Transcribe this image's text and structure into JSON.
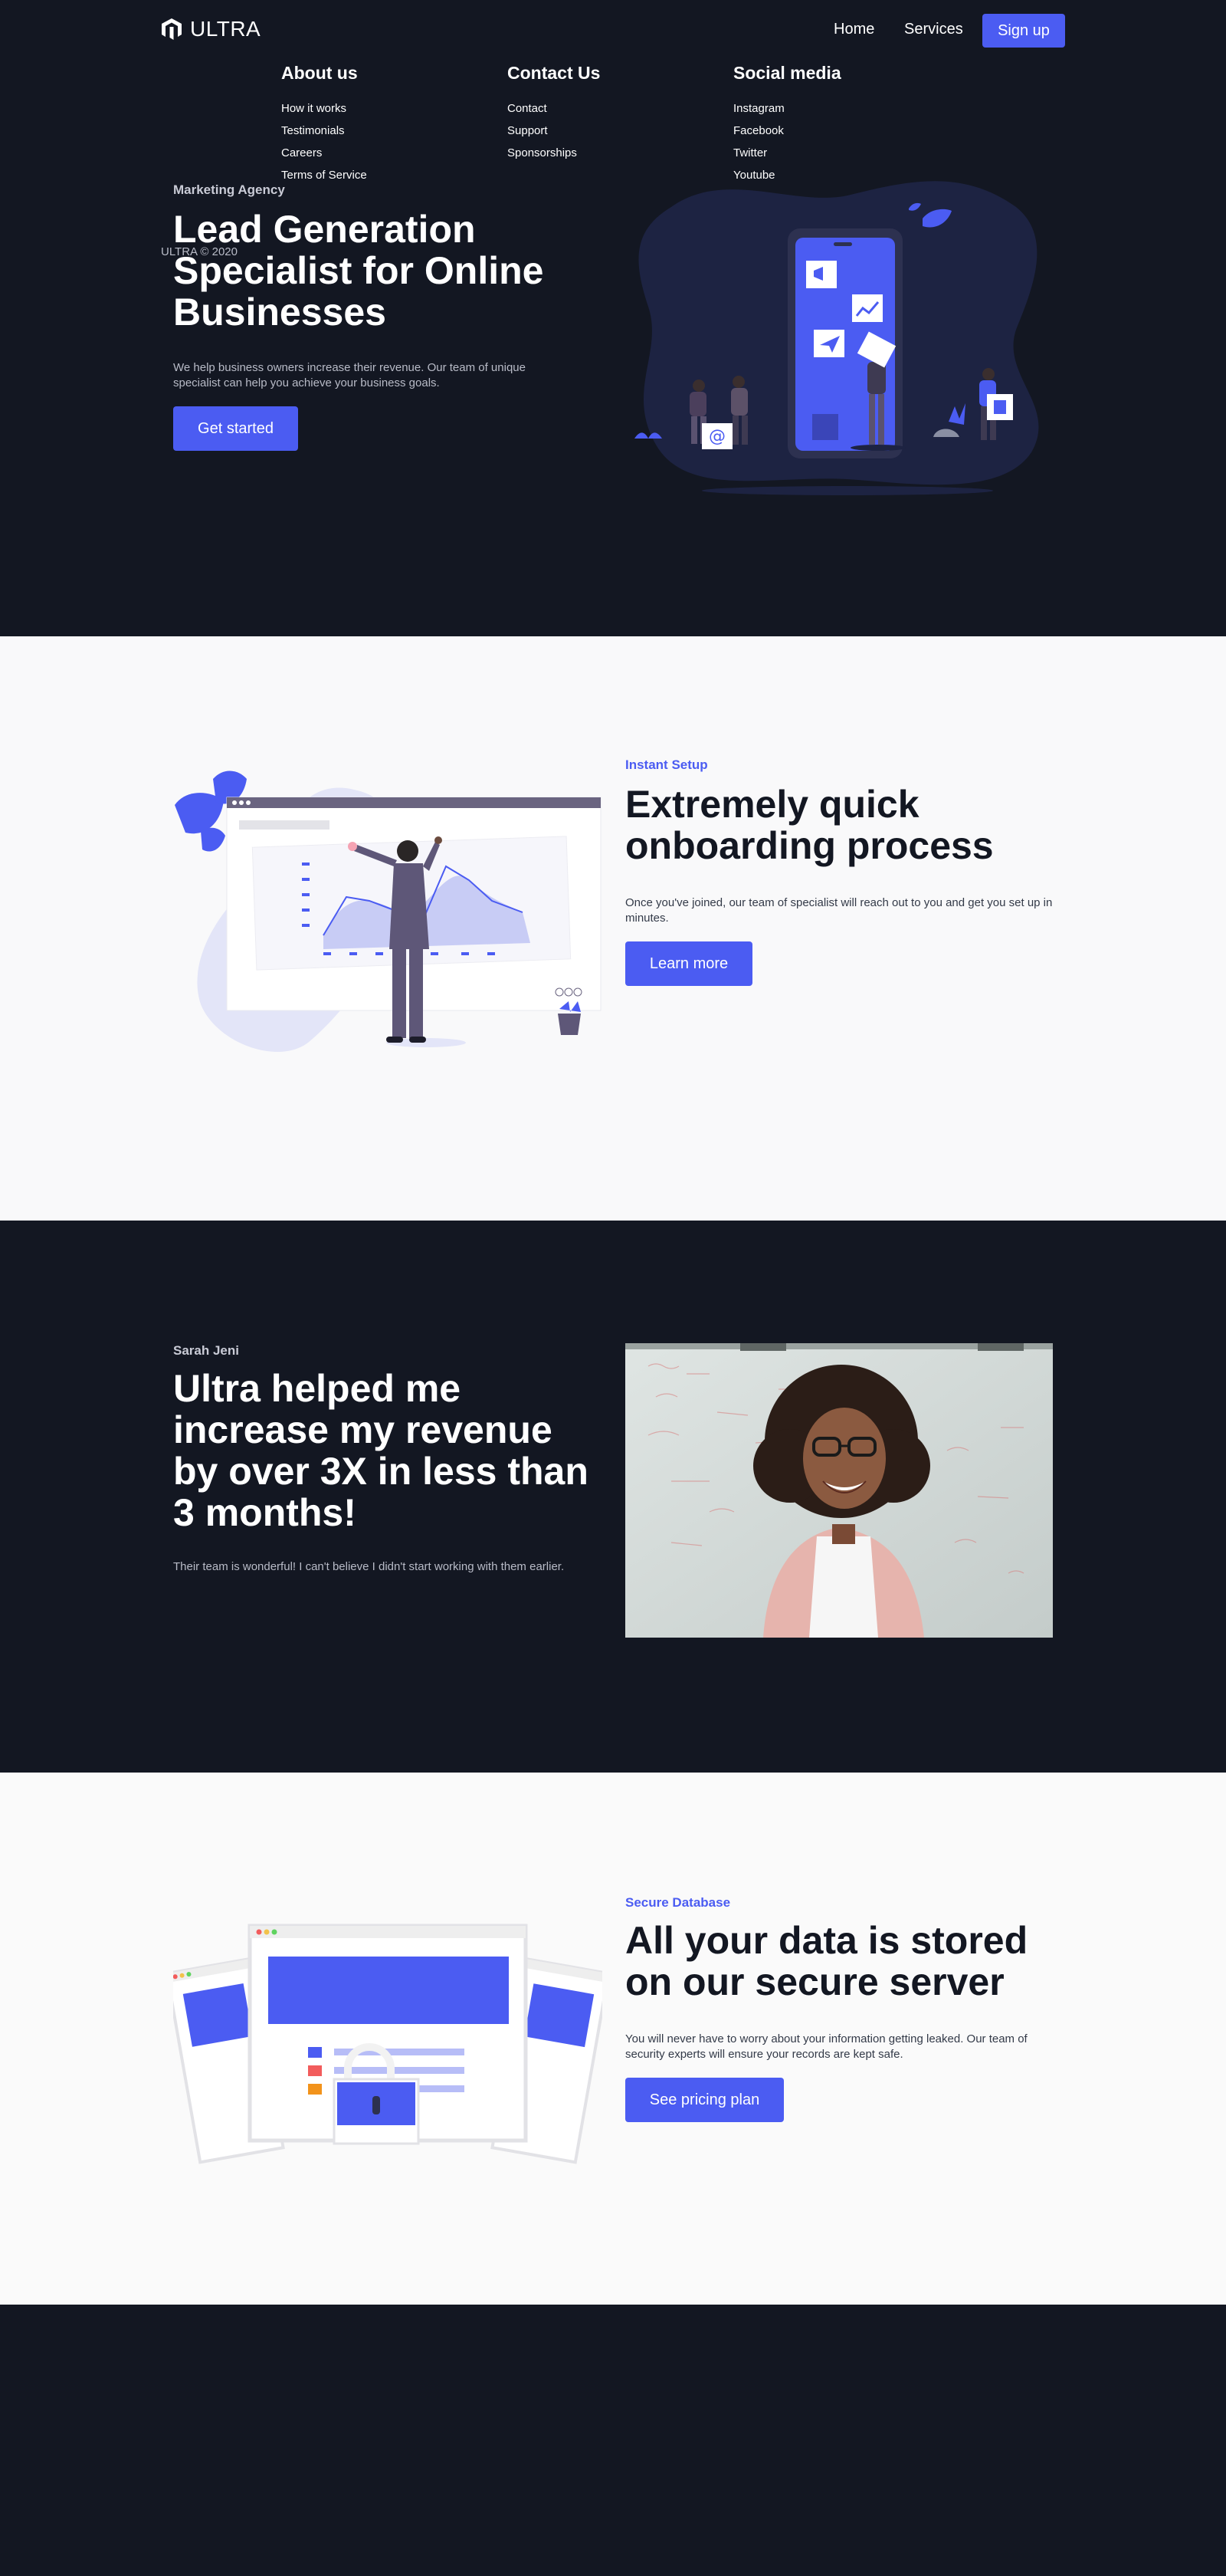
{
  "brand": {
    "name": "ULTRA",
    "accent": "#4b5cf2",
    "dark": "#131722"
  },
  "nav": {
    "logo_icon": "ultra-logo-icon",
    "links": [
      {
        "label": "Home"
      },
      {
        "label": "Services"
      }
    ],
    "signup_label": "Sign up"
  },
  "hero": {
    "eyebrow": "Marketing Agency",
    "title": "Lead Generation Specialist for Online Businesses",
    "description": "We help business owners increase their revenue. Our team of unique specialist can help you achieve your business goals.",
    "cta": "Get started",
    "illustration_icon": "phone-marketing-illustration"
  },
  "onboarding": {
    "eyebrow": "Instant Setup",
    "title": "Extremely quick onboarding process",
    "description": "Once you've joined, our team of specialist will reach out to you and get you set up in minutes.",
    "cta": "Learn more",
    "illustration_icon": "analytics-dashboard-illustration"
  },
  "testimonial": {
    "name": "Sarah Jeni",
    "quote": "Ultra helped me increase my revenue by over 3X in less than 3 months!",
    "description": "Their team is wonderful! I can't believe I didn't start working with them earlier.",
    "photo_icon": "smiling-woman-photo"
  },
  "secure": {
    "eyebrow": "Secure Database",
    "title": "All your data is stored on our secure server",
    "description": "You will never have to worry about your information getting leaked. Our team of security experts will ensure your records are kept safe.",
    "cta": "See pricing plan",
    "illustration_icon": "secure-server-illustration"
  },
  "footer": {
    "columns": [
      {
        "title": "About us",
        "links": [
          "How it works",
          "Testimonials",
          "Careers",
          "Terms of Service"
        ]
      },
      {
        "title": "Contact Us",
        "links": [
          "Contact",
          "Support",
          "Sponsorships"
        ]
      },
      {
        "title": "Social media",
        "links": [
          "Instagram",
          "Facebook",
          "Twitter",
          "Youtube"
        ]
      }
    ],
    "copyright": "ULTRA © 2020"
  }
}
